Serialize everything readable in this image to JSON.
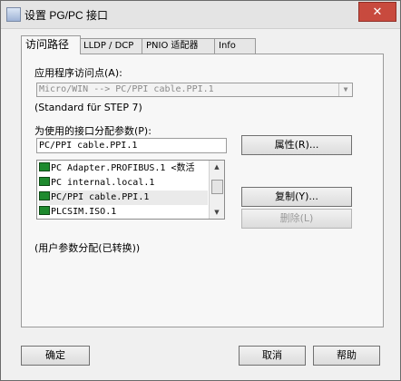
{
  "window": {
    "title": "设置 PG/PC 接口",
    "close_glyph": "✕"
  },
  "tabs": [
    {
      "label": "访问路径"
    },
    {
      "label": "LLDP / DCP"
    },
    {
      "label": "PNIO 适配器"
    },
    {
      "label": "Info"
    }
  ],
  "access_path": {
    "app_access_point_label": "应用程序访问点(A):",
    "app_access_point_value": "Micro/WIN       --> PC/PPI cable.PPI.1",
    "standard_note": "(Standard für STEP 7)",
    "param_assign_label": "为使用的接口分配参数(P):",
    "param_assign_value": "PC/PPI cable.PPI.1",
    "properties_button": "属性(R)...",
    "copy_button": "复制(Y)...",
    "delete_button": "删除(L)",
    "interfaces": [
      {
        "label": "PC Adapter.PROFIBUS.1  <数活"
      },
      {
        "label": "PC internal.local.1"
      },
      {
        "label": "PC/PPI cable.PPI.1"
      },
      {
        "label": "PLCSIM.ISO.1"
      }
    ],
    "footer_note": "(用户参数分配(已转换))"
  },
  "buttons": {
    "ok": "确定",
    "cancel": "取消",
    "help": "帮助"
  }
}
